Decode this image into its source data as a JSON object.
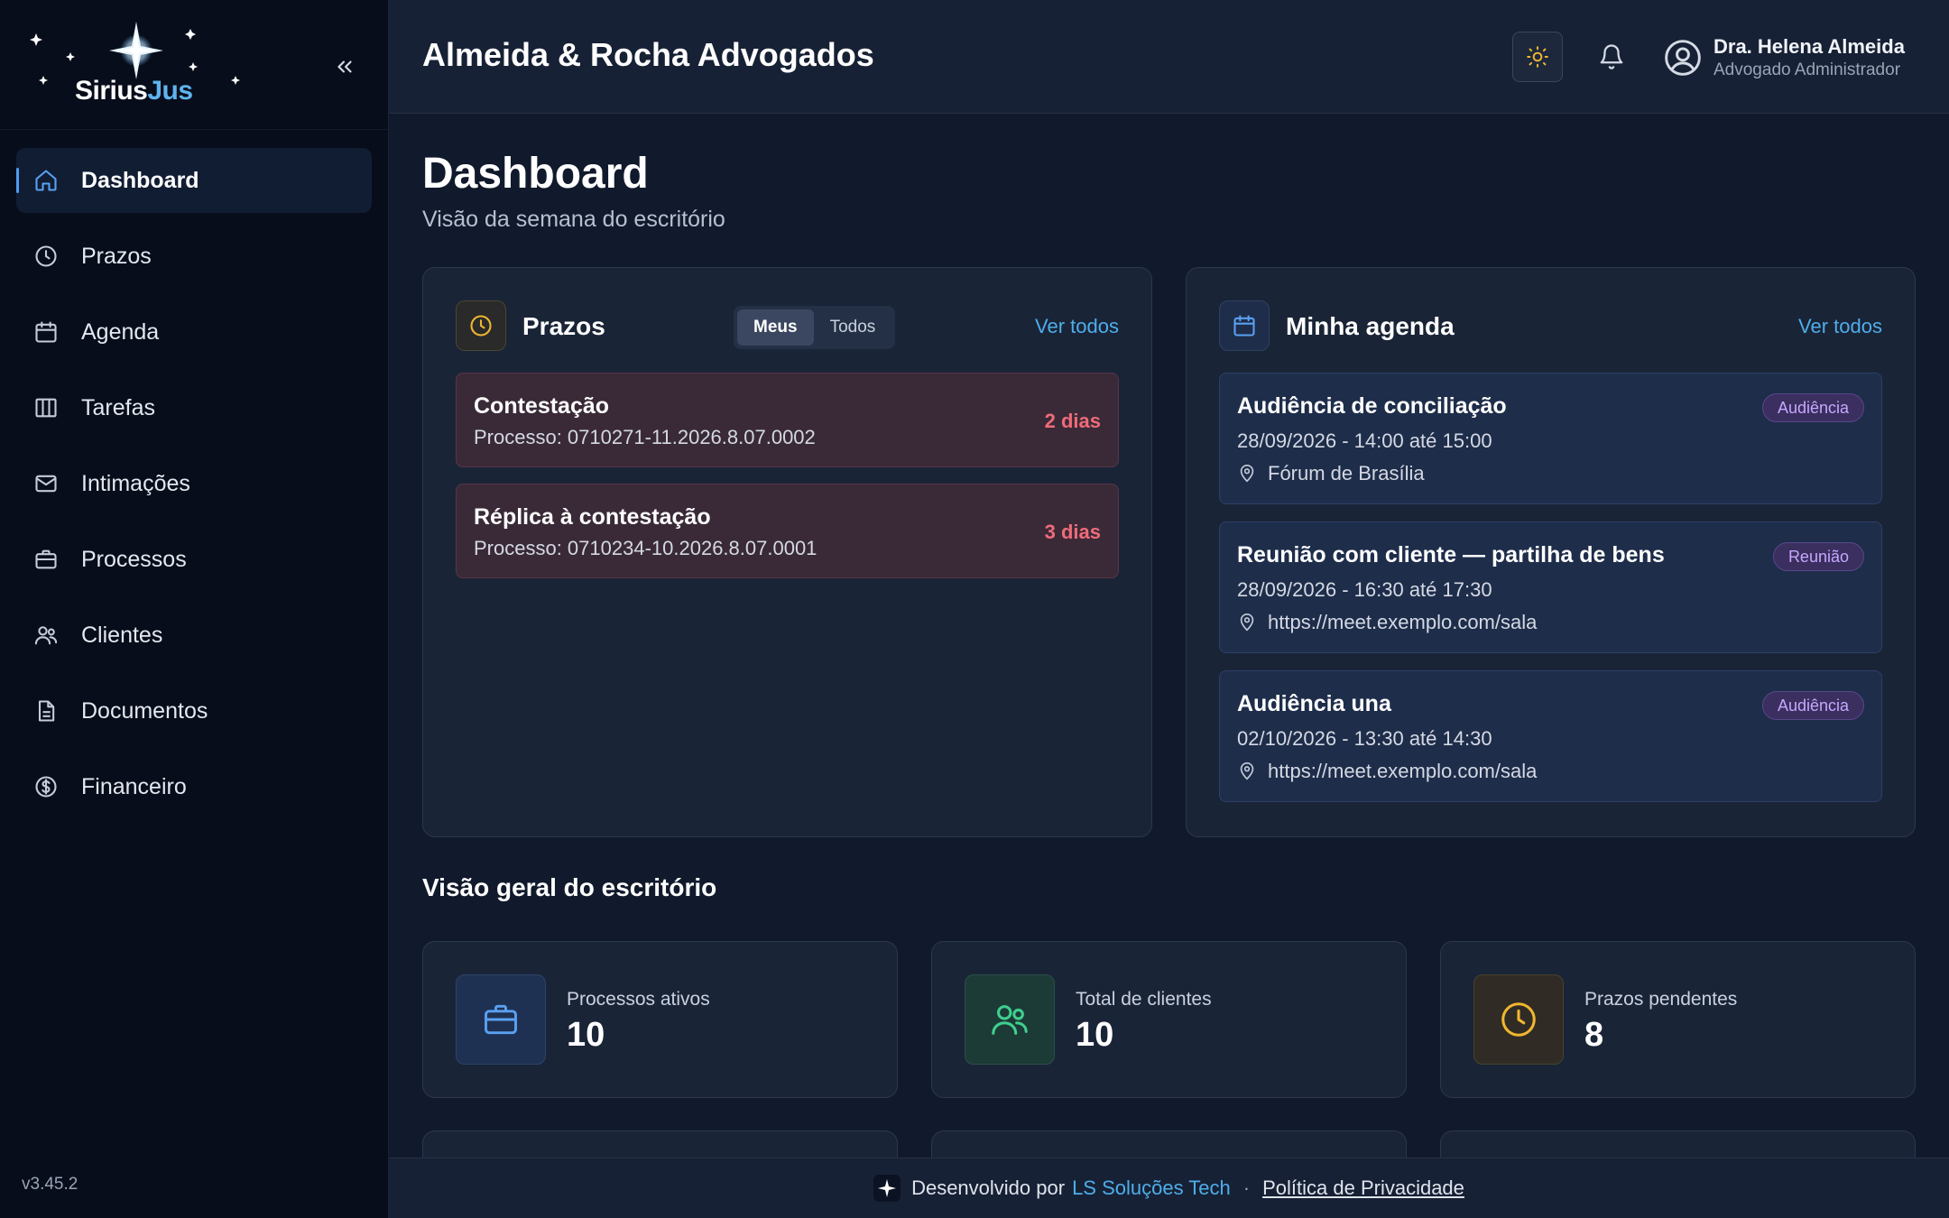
{
  "brand": {
    "logo_part1": "Sirius",
    "logo_part2": "Jus"
  },
  "sidebar": {
    "items": [
      {
        "label": "Dashboard",
        "icon": "home-icon"
      },
      {
        "label": "Prazos",
        "icon": "clock-icon"
      },
      {
        "label": "Agenda",
        "icon": "calendar-icon"
      },
      {
        "label": "Tarefas",
        "icon": "kanban-icon"
      },
      {
        "label": "Intimações",
        "icon": "mail-icon"
      },
      {
        "label": "Processos",
        "icon": "briefcase-icon"
      },
      {
        "label": "Clientes",
        "icon": "users-icon"
      },
      {
        "label": "Documentos",
        "icon": "document-icon"
      },
      {
        "label": "Financeiro",
        "icon": "dollar-icon"
      }
    ],
    "version": "v3.45.2"
  },
  "header": {
    "firm_name": "Almeida & Rocha Advogados",
    "user_name": "Dra. Helena Almeida",
    "user_role": "Advogado Administrador"
  },
  "page": {
    "title": "Dashboard",
    "subtitle": "Visão da semana do escritório"
  },
  "deadlines": {
    "title": "Prazos",
    "see_all": "Ver todos",
    "filter": [
      "Meus",
      "Todos"
    ],
    "items": [
      {
        "title": "Contestação",
        "process": "Processo: 0710271-11.2026.8.07.0002",
        "due": "2 dias"
      },
      {
        "title": "Réplica à contestação",
        "process": "Processo: 0710234-10.2026.8.07.0001",
        "due": "3 dias"
      }
    ]
  },
  "agenda": {
    "title": "Minha agenda",
    "see_all": "Ver todos",
    "items": [
      {
        "title": "Audiência de conciliação",
        "time": "28/09/2026 - 14:00 até 15:00",
        "location": "Fórum de Brasília",
        "badge": "Audiência"
      },
      {
        "title": "Reunião com cliente — partilha de bens",
        "time": "28/09/2026 - 16:30 até 17:30",
        "location": "https://meet.exemplo.com/sala",
        "badge": "Reunião"
      },
      {
        "title": "Audiência una",
        "time": "02/10/2026 - 13:30 até 14:30",
        "location": "https://meet.exemplo.com/sala",
        "badge": "Audiência"
      }
    ]
  },
  "overview": {
    "title": "Visão geral do escritório",
    "stats": [
      {
        "label": "Processos ativos",
        "value": "10",
        "icon": "briefcase-icon",
        "color": "#5aa0f2"
      },
      {
        "label": "Total de clientes",
        "value": "10",
        "icon": "users-icon",
        "color": "#3fcf8e"
      },
      {
        "label": "Prazos pendentes",
        "value": "8",
        "icon": "clock-icon",
        "color": "#f0b72f"
      }
    ]
  },
  "footer": {
    "prefix": "Desenvolvido por",
    "company": "LS Soluções Tech",
    "separator": "·",
    "privacy": "Política de Privacidade"
  },
  "colors": {
    "accent": "#4eaeea",
    "danger": "#ef6b79",
    "badge_purple": "#c6a6ff",
    "warning": "#f0b72f"
  }
}
